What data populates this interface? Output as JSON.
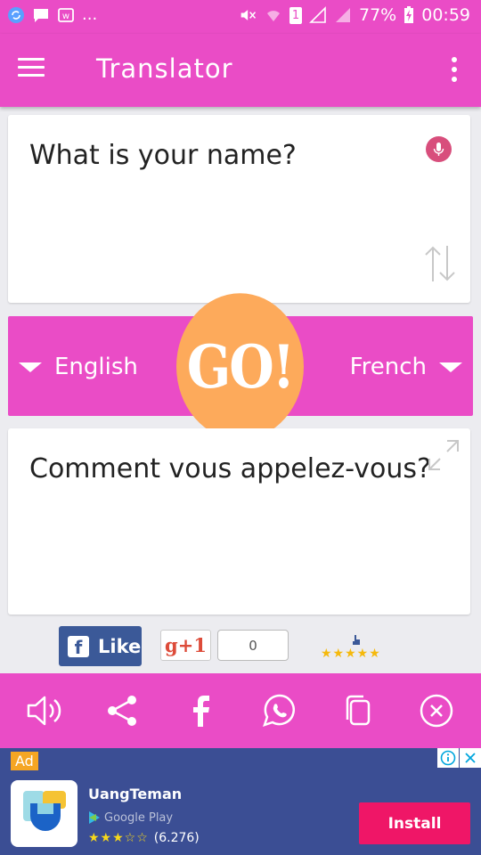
{
  "status_bar": {
    "battery": "77%",
    "time": "00:59",
    "sim_label": "1",
    "overflow": "..."
  },
  "app_bar": {
    "title": "Translator",
    "menu_icon": "hamburger-icon",
    "more_icon": "more-vert-icon"
  },
  "input": {
    "text": "What is your name?",
    "mic_icon": "mic-icon",
    "swap_icon": "swap-vertical-icon"
  },
  "languages": {
    "source": "English",
    "target": "French",
    "go_label": "GO!"
  },
  "output": {
    "text": "Comment vous appelez-vous?",
    "expand_icon": "expand-icon"
  },
  "social": {
    "fb_like_label": "Like",
    "gplus_label": "g+1",
    "gplus_count": "0",
    "rating_stars": "★★★★★"
  },
  "actions": [
    "speaker-icon",
    "share-icon",
    "facebook-icon",
    "whatsapp-icon",
    "copy-icon",
    "close-icon"
  ],
  "ad": {
    "tag": "Ad",
    "app_name": "UangTeman",
    "store": "Google Play",
    "rating_stars": "★★★☆☆",
    "rating_count": "(6.276)",
    "install_label": "Install"
  },
  "colors": {
    "primary": "#ea4cc6",
    "go_button": "#fdaa5b",
    "ad_background": "#3b4e94",
    "install": "#ef1667",
    "facebook": "#3b5998"
  }
}
